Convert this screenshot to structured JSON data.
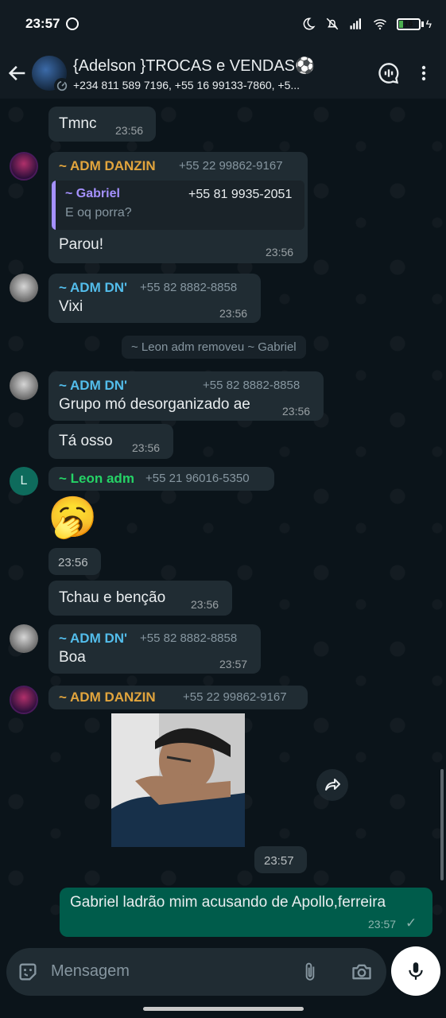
{
  "status_bar": {
    "time": "23:57",
    "battery": "16"
  },
  "header": {
    "title": "{Adelson }TROCAS e VENDAS⚽",
    "subtitle": "+234 811 589 7196, +55 16 99133-7860, +5..."
  },
  "colors": {
    "danzin": "#e2a53d",
    "dn": "#53bdeb",
    "leon": "#25d366",
    "quoted": "#a591ff",
    "outgoing": "#005c4b",
    "incoming": "#202c33"
  },
  "messages": {
    "m1": {
      "text": "Tmnc",
      "time": "23:56"
    },
    "m2": {
      "sender": "~ ADM DANZIN",
      "phone": "+55 22 99862-9167",
      "quote_sender": "~ Gabriel",
      "quote_phone": "+55 81 9935-2051",
      "quote_text": "E oq porra?",
      "text": "Parou!",
      "time": "23:56"
    },
    "m3": {
      "sender": "~ ADM DN'",
      "phone": "+55 82 8882-8858",
      "text": "Vixi",
      "time": "23:56"
    },
    "system": {
      "text": "~ Leon adm removeu ~ Gabriel"
    },
    "m4": {
      "sender": "~ ADM DN'",
      "phone": "+55 82 8882-8858",
      "text": "Grupo mó desorganizado ae",
      "time": "23:56"
    },
    "m5": {
      "text": "Tá osso",
      "time": "23:56"
    },
    "m6": {
      "avatar_letter": "L",
      "sender": "~ Leon adm",
      "phone": "+55 21 96016-5350",
      "emoji": "🥱",
      "time": "23:56"
    },
    "m7": {
      "text": "Tchau e benção",
      "time": "23:56"
    },
    "m8": {
      "sender": "~ ADM DN'",
      "phone": "+55 82 8882-8858",
      "text": "Boa",
      "time": "23:57"
    },
    "m9": {
      "sender": "~ ADM DANZIN",
      "phone": "+55 22 99862-9167",
      "time": "23:57"
    },
    "m10": {
      "text": "Gabriel ladrão mim acusando de Apollo,ferreira",
      "time": "23:57",
      "status": "✓"
    }
  },
  "composer": {
    "placeholder": "Mensagem"
  },
  "icons": [
    "whatsapp-icon",
    "moon-icon",
    "mute-icon",
    "signal-icon",
    "wifi-icon",
    "battery-icon",
    "back-arrow-icon",
    "timer-icon",
    "voice-chat-icon",
    "more-vert-icon",
    "forward-icon",
    "sticker-icon",
    "attach-icon",
    "camera-icon",
    "mic-icon"
  ]
}
